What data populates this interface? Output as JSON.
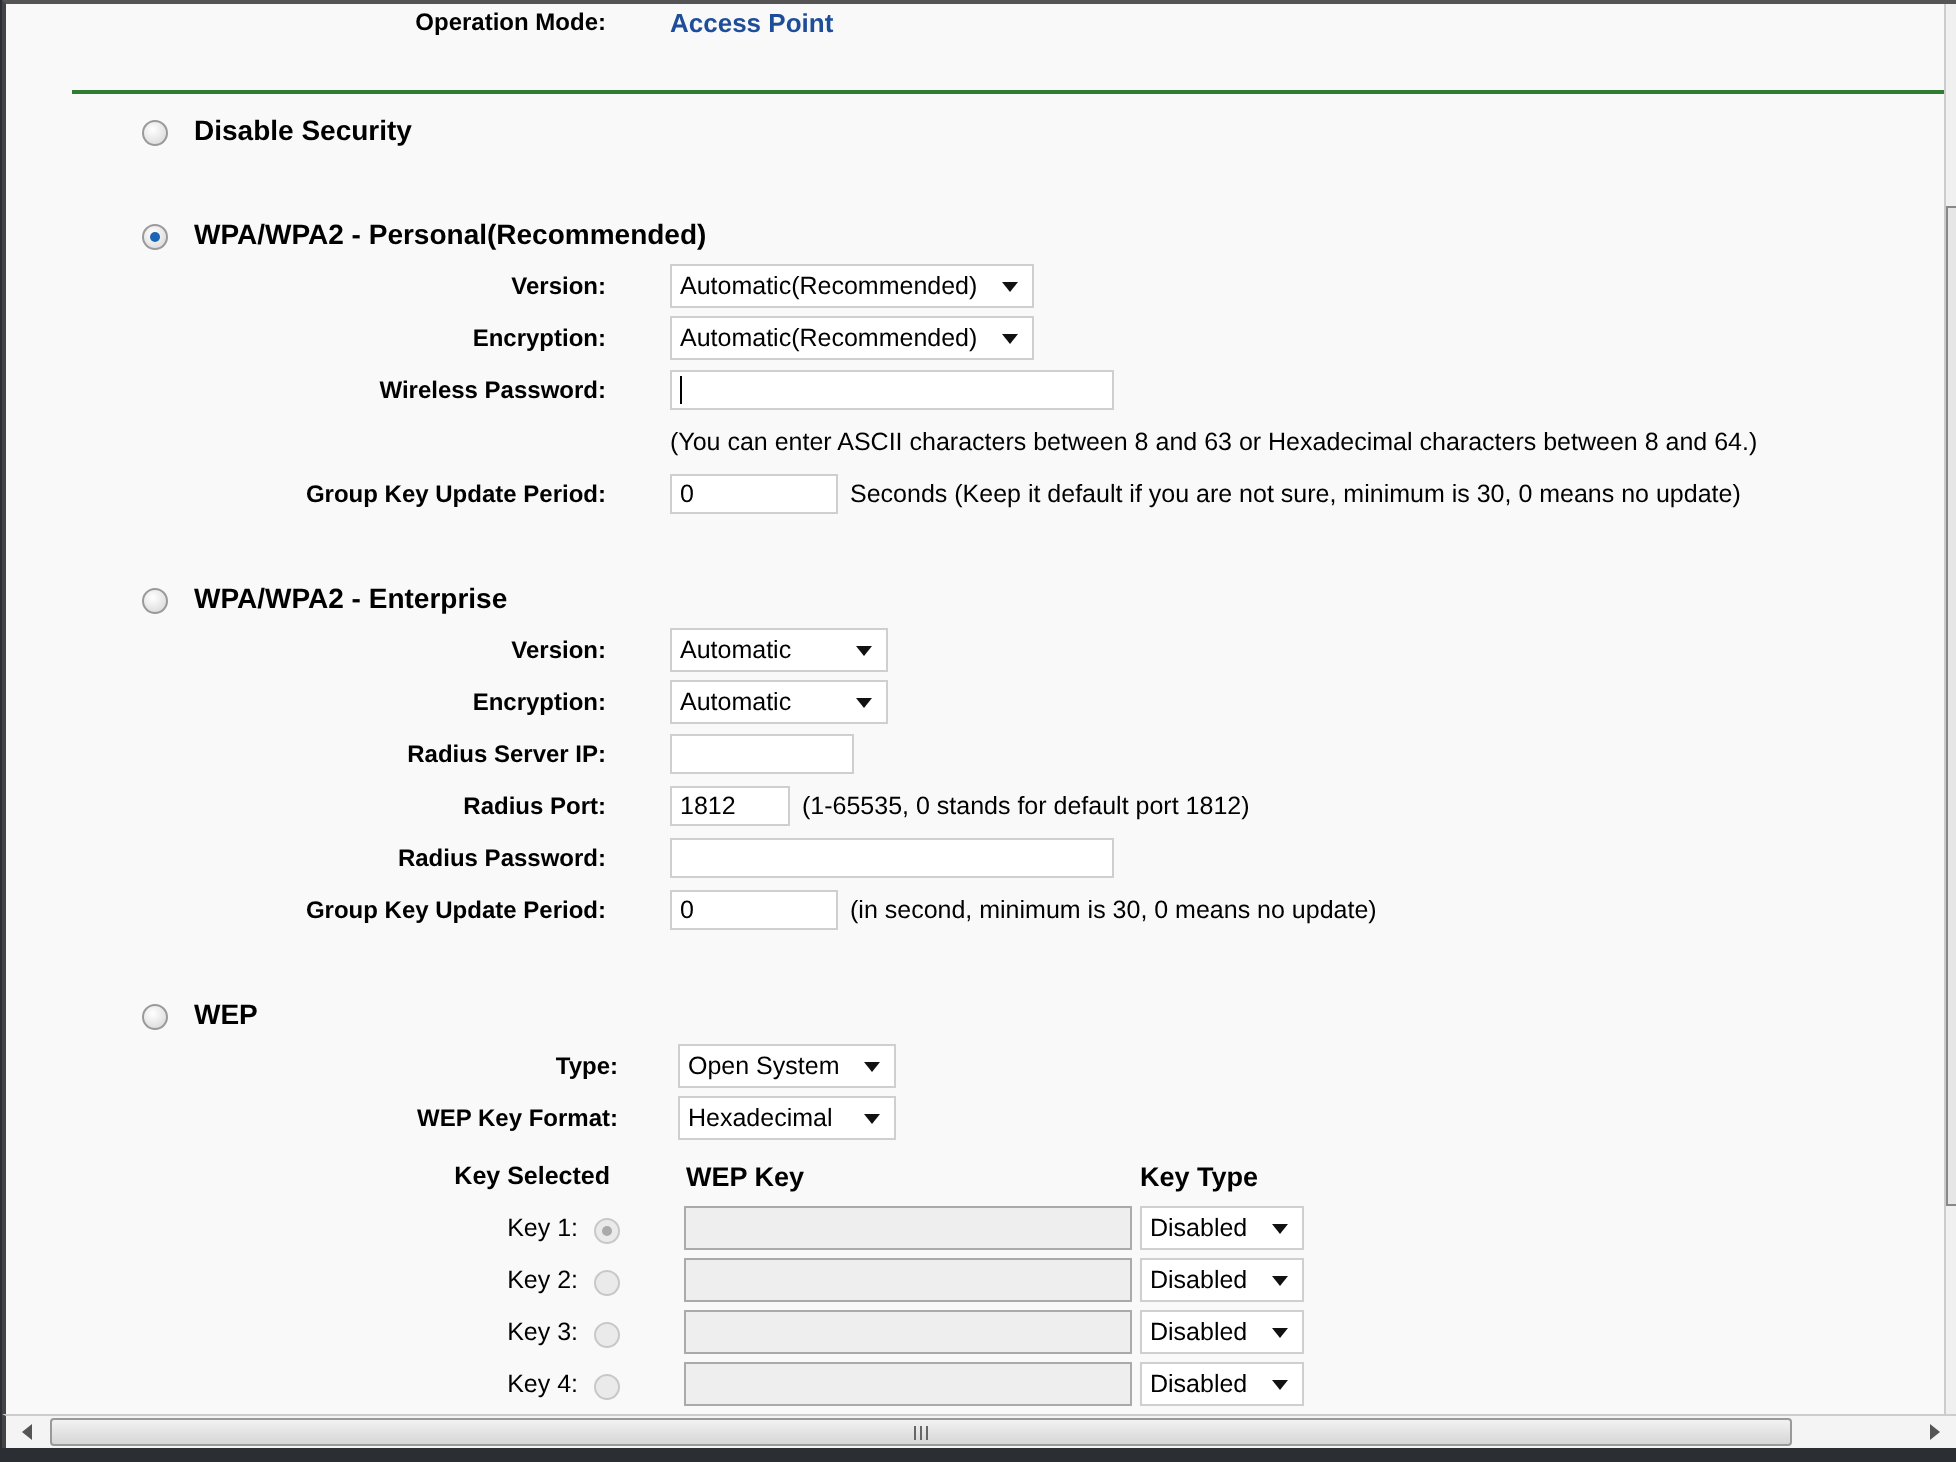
{
  "operation_mode": {
    "label": "Operation Mode:",
    "value": "Access Point"
  },
  "sections": [
    {
      "title": "Disable Security",
      "selected": false
    },
    {
      "title": "WPA/WPA2 - Personal(Recommended)",
      "selected": true,
      "fields": [
        {
          "kind": "select",
          "label": "Version:",
          "value": "Automatic(Recommended)"
        },
        {
          "kind": "select",
          "label": "Encryption:",
          "value": "Automatic(Recommended)"
        },
        {
          "kind": "text",
          "label": "Wireless Password:",
          "focused": true
        },
        {
          "kind": "note",
          "text": "(You can enter ASCII characters between 8 and 63 or Hexadecimal characters between 8 and 64.)"
        },
        {
          "kind": "text",
          "label": "Group Key Update Period:",
          "value": "0",
          "hint": "Seconds (Keep it default if you are not sure, minimum is 30, 0 means no update)"
        }
      ]
    },
    {
      "title": "WPA/WPA2 - Enterprise",
      "selected": false,
      "fields": [
        {
          "kind": "select",
          "label": "Version:",
          "value": "Automatic"
        },
        {
          "kind": "select",
          "label": "Encryption:",
          "value": "Automatic"
        },
        {
          "kind": "text",
          "label": "Radius Server IP:"
        },
        {
          "kind": "text",
          "label": "Radius Port:",
          "value": "1812",
          "hint": "(1-65535, 0 stands for default port 1812)"
        },
        {
          "kind": "text",
          "label": "Radius Password:"
        },
        {
          "kind": "text",
          "label": "Group Key Update Period:",
          "value": "0",
          "hint": "(in second, minimum is 30, 0 means no update)"
        }
      ]
    },
    {
      "title": "WEP",
      "selected": false,
      "fields": [
        {
          "kind": "select",
          "label": "Type:",
          "value": "Open System"
        },
        {
          "kind": "select",
          "label": "WEP Key Format:",
          "value": "Hexadecimal"
        }
      ],
      "key_table": {
        "headers": [
          "Key Selected",
          "WEP Key",
          "Key Type"
        ],
        "disabled": true,
        "keys": [
          {
            "label": "Key 1:",
            "selected": true,
            "key_type": "Disabled"
          },
          {
            "label": "Key 2:",
            "selected": false,
            "key_type": "Disabled"
          },
          {
            "label": "Key 3:",
            "selected": false,
            "key_type": "Disabled"
          },
          {
            "label": "Key 4:",
            "selected": false,
            "key_type": "Disabled"
          }
        ]
      }
    }
  ]
}
